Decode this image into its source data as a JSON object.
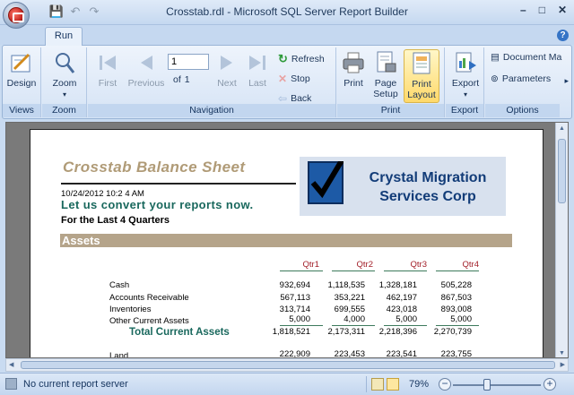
{
  "window": {
    "title": "Crosstab.rdl - Microsoft SQL Server Report Builder",
    "controls": [
      "–",
      "□",
      "✕"
    ]
  },
  "ribbon": {
    "tab": "Run",
    "views": {
      "label": "Views",
      "design": "Design"
    },
    "zoom": {
      "label": "Zoom",
      "zoom": "Zoom"
    },
    "navigation": {
      "label": "Navigation",
      "first": "First",
      "previous": "Previous",
      "page": "1",
      "of": "of",
      "total": "1",
      "next": "Next",
      "last": "Last",
      "refresh": "Refresh",
      "stop": "Stop",
      "back": "Back"
    },
    "print": {
      "label": "Print",
      "print": "Print",
      "page_setup": "Page Setup",
      "print_layout": "Print Layout"
    },
    "export": {
      "label": "Export",
      "export": "Export"
    },
    "options": {
      "label": "Options",
      "document_map": "Document Ma",
      "parameters": "Parameters"
    }
  },
  "report": {
    "title": "Crosstab Balance Sheet",
    "date": "10/24/2012  10:2 4 AM",
    "tagline": "Let us convert your reports now.",
    "period": "For the Last 4 Quarters",
    "logo_line1": "Crystal Migration",
    "logo_line2": "Services Corp",
    "section": "Assets",
    "quarters": [
      "Qtr1",
      "Qtr2",
      "Qtr3",
      "Qtr4"
    ],
    "rows": [
      {
        "label": "Cash",
        "values": [
          "932,694",
          "1,118,535",
          "1,328,181",
          "505,228"
        ]
      },
      {
        "label": "Accounts Receivable",
        "values": [
          "567,113",
          "353,221",
          "462,197",
          "867,503"
        ]
      },
      {
        "label": "Inventories",
        "values": [
          "313,714",
          "699,555",
          "423,018",
          "893,008"
        ]
      },
      {
        "label": "Other Current Assets",
        "values": [
          "5,000",
          "4,000",
          "5,000",
          "5,000"
        ]
      }
    ],
    "total": {
      "label": "Total Current Assets",
      "values": [
        "1,818,521",
        "2,173,311",
        "2,218,396",
        "2,270,739"
      ]
    },
    "land": {
      "label": "Land",
      "values": [
        "222,909",
        "223,453",
        "223,541",
        "223,755"
      ]
    }
  },
  "status": {
    "server": "No current report server",
    "zoom": "79%"
  }
}
